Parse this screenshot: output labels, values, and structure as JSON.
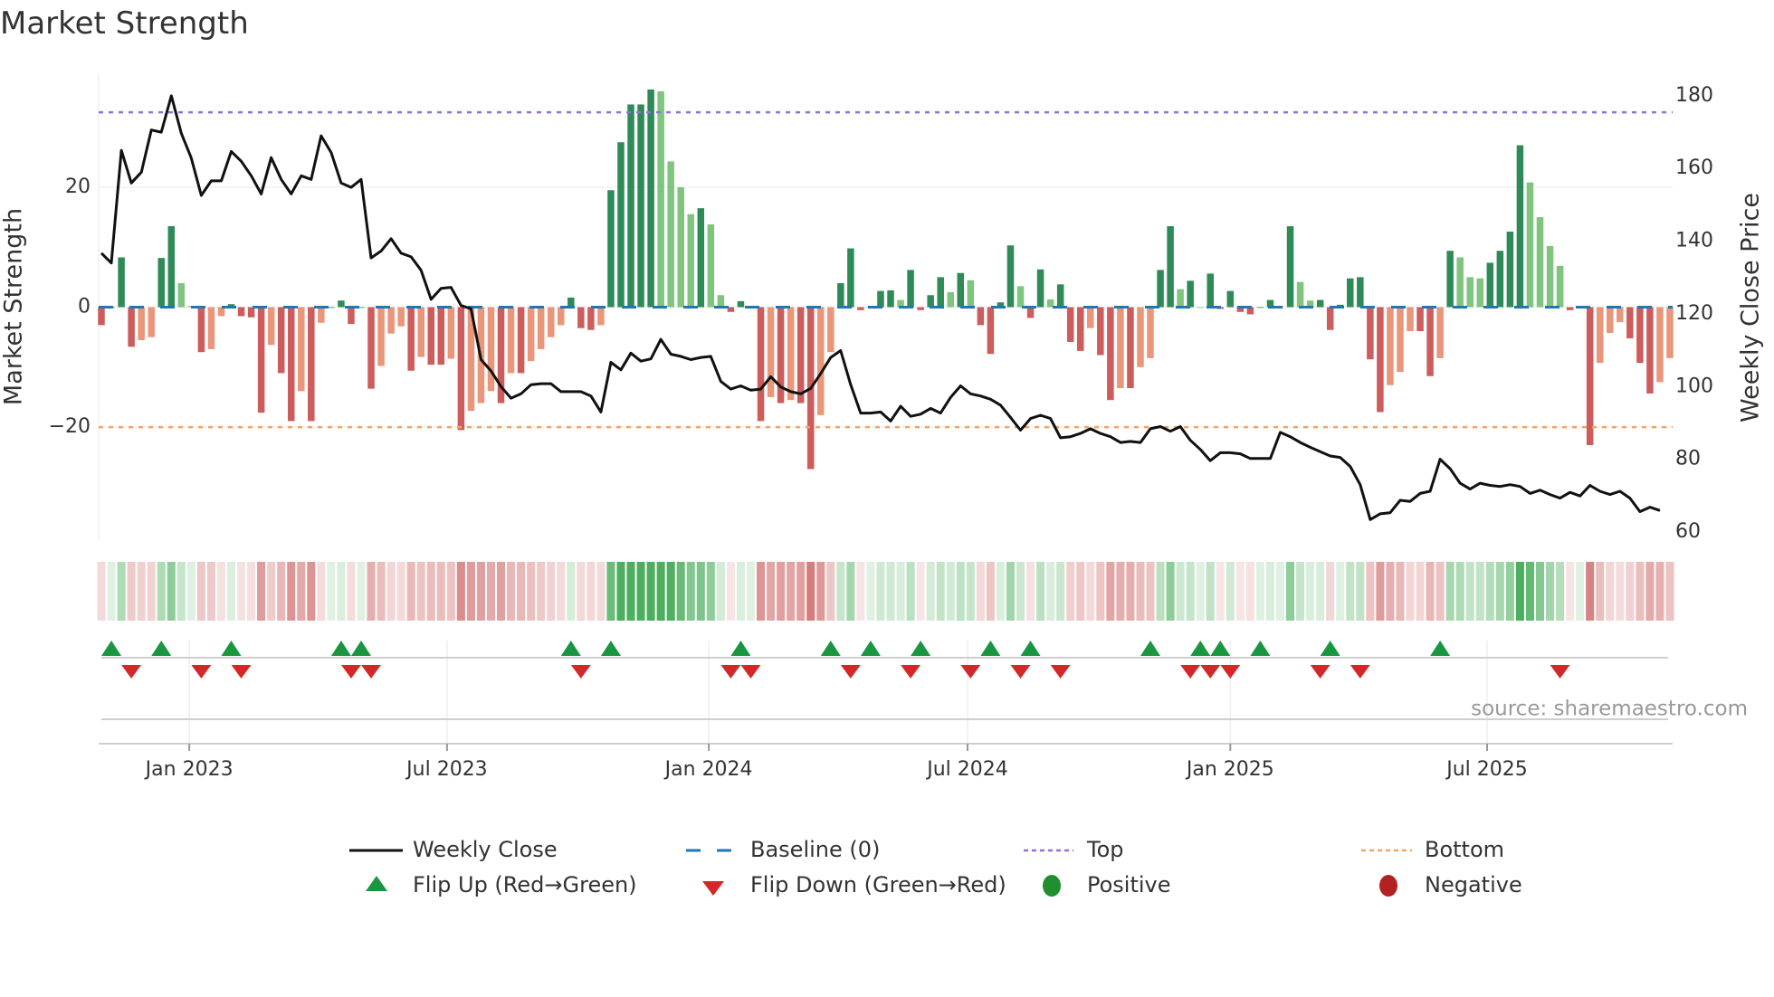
{
  "chart_data": {
    "type": "bar",
    "title": "Market Strength",
    "ylabel": "Market Strength",
    "y2label": "Weekly Close Price",
    "ylim": [
      -39,
      39
    ],
    "y2lim": [
      57.5,
      186.2
    ],
    "yticks": [
      -20,
      0,
      20
    ],
    "yticklabels": [
      "−20",
      "0",
      "20"
    ],
    "y2ticks": [
      60,
      80,
      100,
      120,
      140,
      160,
      180
    ],
    "xtick_labels": [
      "Jan 2023",
      "Jul 2023",
      "Jan 2024",
      "Jul 2024",
      "Jan 2025",
      "Jul 2025"
    ],
    "xtick_week_index": [
      8.8,
      34.6,
      60.8,
      86.7,
      113,
      138.7
    ],
    "top_level": 32.5,
    "bottom_level": -20,
    "grid": true,
    "source": "source: sharemaestro.com",
    "legend_position": "bottom",
    "legend": {
      "weekly_close": "Weekly Close",
      "baseline": "Baseline (0)",
      "top": "Top",
      "bottom": "Bottom",
      "flip_up": "Flip Up (Red→Green)",
      "flip_down": "Flip Down (Green→Red)",
      "positive": "Positive",
      "negative": "Negative"
    },
    "strength": [
      -3,
      0,
      8.3,
      -6.6,
      -5.5,
      -5,
      8.2,
      13.5,
      4,
      0.2,
      -7.5,
      -7,
      -1.5,
      0.5,
      -1.5,
      -1.7,
      -17.6,
      -6.3,
      -11,
      -19,
      -14,
      -19,
      -2.6,
      0,
      1.1,
      -2.8,
      0,
      -13.6,
      -9.8,
      -4.4,
      -3.2,
      -10.6,
      -8.3,
      -9.6,
      -9.6,
      -8.6,
      -20.5,
      -17.3,
      -16,
      -14,
      -16,
      -11,
      -11,
      -9,
      -7,
      -5,
      -3,
      1.6,
      -3.5,
      -3.8,
      -3,
      19.5,
      27.5,
      33.8,
      33.8,
      36.3,
      36,
      24.3,
      20,
      15.5,
      16.5,
      13.8,
      2,
      -0.8,
      1,
      0,
      -19,
      -15,
      -16,
      -15.5,
      -16,
      -27,
      -18,
      -7.5,
      4,
      9.8,
      -0.5,
      0,
      2.7,
      2.8,
      1.2,
      6.2,
      -0.5,
      2,
      5,
      2.5,
      5.7,
      4.5,
      -3,
      -7.8,
      0.8,
      10.3,
      3.5,
      -1.8,
      6.3,
      1.3,
      3.8,
      -5.8,
      -7.3,
      -3.5,
      -8,
      -15.5,
      -13.5,
      -13.5,
      -10,
      -8.5,
      6.2,
      13.5,
      3,
      4.4,
      0,
      5.6,
      -0.3,
      2.7,
      -0.8,
      -1.2,
      0,
      1.2,
      0,
      13.5,
      4.2,
      1.1,
      1.2,
      -3.8,
      0.4,
      4.8,
      5,
      -8.7,
      -17.5,
      -13,
      -10.8,
      -4,
      -4,
      -11.5,
      -8.5,
      9.4,
      8.3,
      5,
      4.8,
      7.4,
      9.4,
      12.6,
      27,
      20.8,
      15,
      10.2,
      6.9,
      -0.5,
      0,
      -23,
      -9.3,
      -4.3,
      -2.5,
      -5.2,
      -9.3,
      -14.4,
      -12.5,
      -8.5
    ],
    "weekly_close": [
      136.7,
      134,
      165,
      156,
      159,
      170.6,
      170,
      180,
      169.7,
      162.9,
      152.6,
      156.6,
      156.6,
      164.7,
      162,
      158,
      153,
      163,
      157,
      153,
      158,
      157,
      169,
      164.4,
      156,
      154.8,
      157,
      135.4,
      137.3,
      140.7,
      136.7,
      135.7,
      132,
      124,
      127,
      127.3,
      122.3,
      121.4,
      107.4,
      104.3,
      100,
      96.8,
      98,
      100.5,
      100.8,
      100.8,
      98.6,
      98.6,
      98.6,
      97.4,
      93,
      106.7,
      104.6,
      109.2,
      107,
      107.6,
      113,
      108.9,
      108.3,
      107.4,
      108,
      108.3,
      101.4,
      99.3,
      100.2,
      99,
      99.3,
      102.7,
      99.9,
      98.6,
      98,
      99.5,
      103.6,
      108,
      109.9,
      100.5,
      92.7,
      92.7,
      93,
      90.5,
      94.6,
      91.8,
      92.4,
      94,
      92.7,
      97,
      100.2,
      98,
      97.4,
      96.5,
      94.9,
      91.5,
      88,
      91.2,
      92.1,
      91.2,
      85.9,
      86.2,
      87.1,
      88.4,
      87.1,
      86.2,
      84.6,
      84.9,
      84.6,
      88.4,
      89,
      87.7,
      89,
      85.2,
      82.7,
      79.6,
      81.8,
      81.8,
      81.5,
      80.2,
      80.2,
      80.2,
      87.4,
      86.2,
      84.6,
      83.3,
      82.1,
      80.9,
      80.5,
      78,
      73,
      63.4,
      65,
      65.3,
      68.7,
      68.4,
      70.6,
      71.2,
      80,
      77.4,
      73.4,
      71.8,
      73.4,
      72.8,
      72.5,
      73,
      72.5,
      70.6,
      71.5,
      70.3,
      69.3,
      70.9,
      69.9,
      72.8,
      71.2,
      70.3,
      71.2,
      69.3,
      65.6,
      66.8,
      65.9
    ],
    "flip_up_week_index": [
      1,
      6,
      13,
      24,
      26,
      47,
      51,
      64,
      73,
      77,
      82,
      89,
      93,
      105,
      110,
      112,
      116,
      123,
      134
    ],
    "flip_down_week_index": [
      3,
      10,
      14,
      25,
      27,
      48,
      63,
      65,
      75,
      81,
      87,
      92,
      96,
      109,
      111,
      113,
      122,
      126,
      146
    ]
  },
  "colors": {
    "pos_rising": "#2e8b57",
    "pos_falling": "#7fc47f",
    "neg_falling": "#cd5c5c",
    "neg_rising": "#e9967a",
    "baseline": "#1f77b4",
    "top": "#9370db",
    "bottom": "#f4a460",
    "flip_up": "#1a9641",
    "flip_down": "#d62728",
    "positive": "#1f8f2f",
    "negative": "#b22222"
  }
}
